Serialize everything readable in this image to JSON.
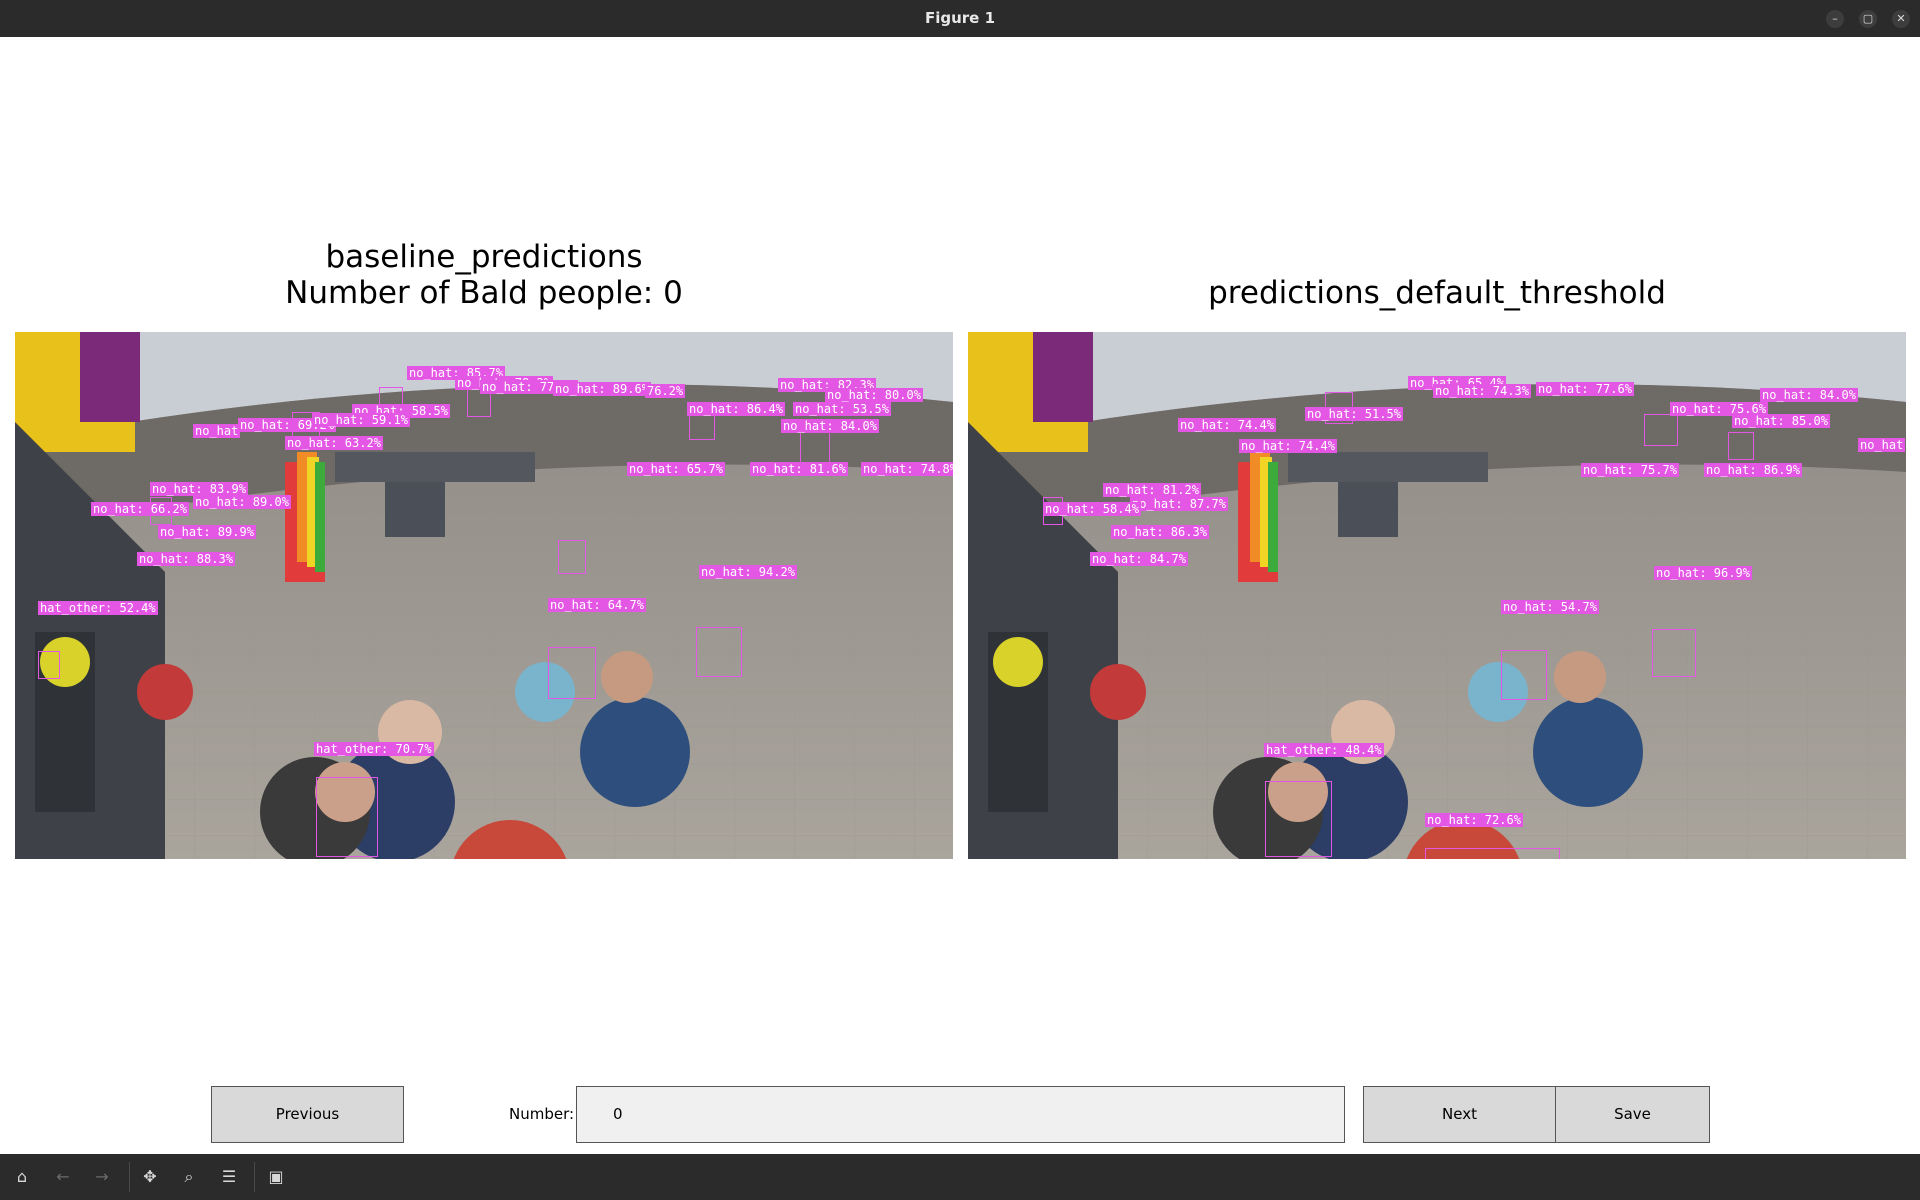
{
  "window": {
    "title": "Figure 1"
  },
  "window_controls": {
    "minimize": "–",
    "maximize": "▢",
    "close": "✕"
  },
  "left": {
    "title_line1": "baseline_predictions",
    "title_line2": "Number of Bald people: 0",
    "labels": [
      "no_hat: 85.7%",
      "no_hat: 78.2%",
      "no_hat: 77.7%",
      "no_hat: 89.6%",
      "76.2%",
      "no_hat: 82.3%",
      "no_hat: 80.0%",
      "no_hat: 86.4%",
      "no_hat: 53.5%",
      "no_hat: 84.0%",
      "no_hat: 58.5%",
      "no_hat: 69.2%",
      "no_hat: 59.1%",
      "no_hat: 63.2%",
      "no_hat: 65.7%",
      "no_hat: 81.6%",
      "no_hat: 74.8%",
      "no_hat: 83.9%",
      "no_hat: 89.0%",
      "no_hat: 66.2%",
      "no_hat: 89.9%",
      "no_hat: 88.3%",
      "no_hat: 94.2%",
      "hat_other: 52.4%",
      "no_hat: 64.7%",
      "hat_other: 70.7%",
      "no_hat"
    ]
  },
  "right": {
    "title": "predictions_default_threshold",
    "labels": [
      "no_hat: 65.4%",
      "no_hat: 74.3%",
      "no_hat: 77.6%",
      "no_hat: 84.0%",
      "no_hat: 75.6%",
      "no_hat: 85.0%",
      "no_hat: 51.5%",
      "no_hat: 74.4%",
      "no_hat: 74.4%",
      "no_hat: 75.7%",
      "no_hat: 86.9%",
      "no_hat: 81.2%",
      "no_hat: 87.7%",
      "no_hat: 58.4%",
      "no_hat: 86.3%",
      "no_hat: 84.7%",
      "no_hat: 96.9%",
      "no_hat: 54.7%",
      "hat_other: 48.4%",
      "no_hat: 72.6%",
      "no_hat"
    ]
  },
  "controls": {
    "previous_label": "Previous",
    "number_label": "Number:",
    "number_value": "0",
    "next_label": "Next",
    "save_label": "Save"
  },
  "toolbar": {
    "home_icon": "⌂",
    "back_icon": "←",
    "forward_icon": "→",
    "pan_icon": "✥",
    "zoom_icon": "⌕",
    "configure_icon": "☰",
    "save_icon": "▣"
  }
}
